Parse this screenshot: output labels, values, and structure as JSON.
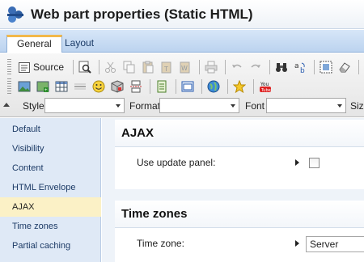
{
  "window": {
    "title": "Web part properties (Static HTML)"
  },
  "tabs": [
    {
      "label": "General",
      "active": true
    },
    {
      "label": "Layout",
      "active": false
    }
  ],
  "toolbar": {
    "source_label": "Source",
    "combos": {
      "style_label": "Style",
      "format_label": "Format",
      "font_label": "Font",
      "size_label": "Size"
    }
  },
  "sidebar": {
    "items": [
      {
        "label": "Default"
      },
      {
        "label": "Visibility"
      },
      {
        "label": "Content"
      },
      {
        "label": "HTML Envelope"
      },
      {
        "label": "AJAX",
        "active": true
      },
      {
        "label": "Time zones"
      },
      {
        "label": "Partial caching"
      }
    ]
  },
  "sections": {
    "ajax": {
      "title": "AJAX",
      "update_panel_label": "Use update panel:",
      "update_panel_checked": false
    },
    "timezones": {
      "title": "Time zones",
      "timezone_label": "Time zone:",
      "timezone_value": "Server"
    }
  },
  "colors": {
    "accent_tab": "#f2b84b",
    "sidebar_bg": "#dfe9f6",
    "sidebar_active": "#fbf1c6"
  }
}
